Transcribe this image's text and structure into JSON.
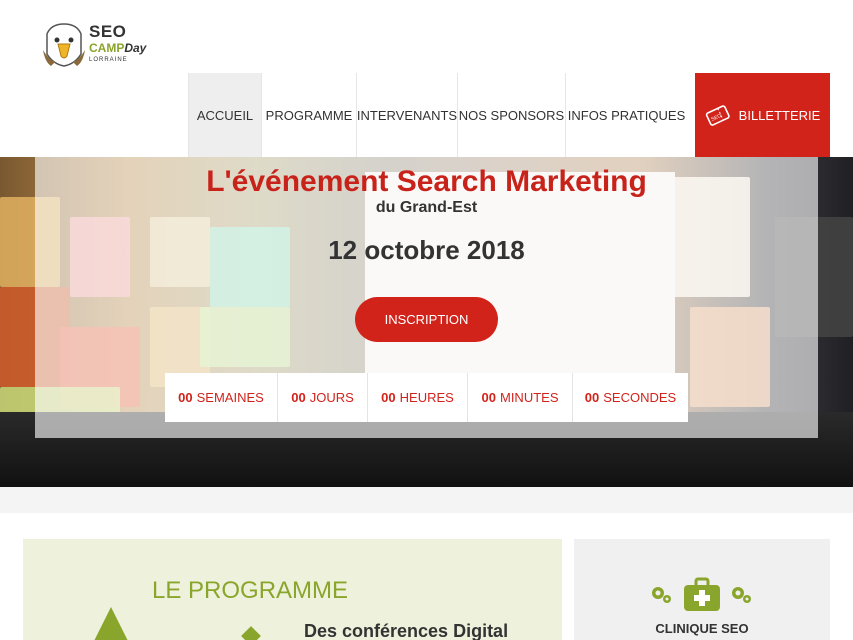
{
  "logo": {
    "seo": "SEO",
    "camp": "CAMP",
    "day": "Day",
    "region": "LORRAINE"
  },
  "nav": {
    "items": [
      {
        "label": "ACCUEIL",
        "active": true
      },
      {
        "label": "PROGRAMME",
        "active": false
      },
      {
        "label": "INTERVENANTS",
        "active": false
      },
      {
        "label": "NOS SPONSORS",
        "active": false
      },
      {
        "label": "INFOS PRATIQUES",
        "active": false
      }
    ],
    "ticket": {
      "label": "BILLETTERIE",
      "icon": "ticket-icon",
      "icon_text": "SEO"
    }
  },
  "hero": {
    "title": "L'événement Search Marketing",
    "subtitle": "du Grand-Est",
    "date": "12 octobre 2018",
    "cta": "INSCRIPTION"
  },
  "countdown": [
    {
      "num": "00",
      "unit": "SEMAINES"
    },
    {
      "num": "00",
      "unit": "JOURS"
    },
    {
      "num": "00",
      "unit": "HEURES"
    },
    {
      "num": "00",
      "unit": "MINUTES"
    },
    {
      "num": "00",
      "unit": "SECONDES"
    }
  ],
  "program": {
    "title": "LE PROGRAMME",
    "subtitle": "Des conférences Digital"
  },
  "clinic": {
    "label": "CLINIQUE SEO",
    "icons": [
      "gears-icon",
      "medical-kit-icon",
      "gears-icon"
    ]
  },
  "colors": {
    "accent_red": "#d2231b",
    "accent_green": "#8aa52c"
  }
}
